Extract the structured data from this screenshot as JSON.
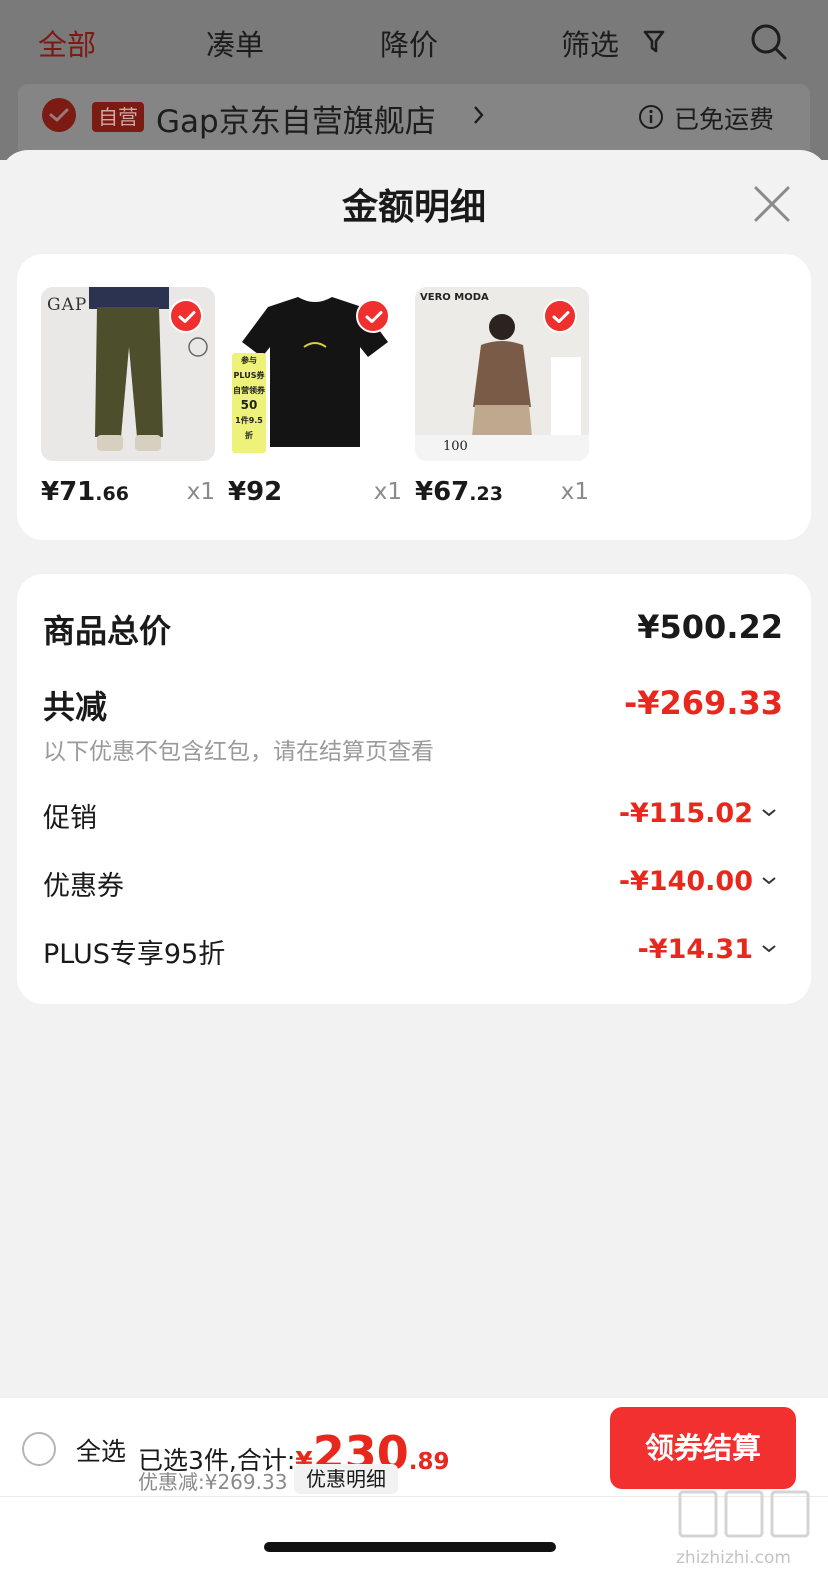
{
  "background": {
    "tabs": [
      "全部",
      "凑单",
      "降价",
      "筛选"
    ],
    "active_tab": "全部",
    "store": {
      "tag": "自营",
      "name": "Gap京东自营旗舰店",
      "shipping": "已免运费"
    }
  },
  "sheet": {
    "title": "金额明细",
    "products": [
      {
        "price_int": "¥71",
        "price_dec": ".66",
        "qty": "x1",
        "brand_text": "GAP"
      },
      {
        "price_int": "¥92",
        "price_dec": "",
        "qty": "x1",
        "promo_lines": [
          "参与",
          "PLUS券",
          "自营领券",
          "50",
          "1件9.5折"
        ]
      },
      {
        "price_int": "¥67",
        "price_dec": ".23",
        "qty": "x1",
        "brand_text": "VERO MODA",
        "promo_price": "100"
      }
    ],
    "summary": {
      "total_label": "商品总价",
      "total_value": "¥500.22",
      "reduce_label": "共减",
      "reduce_value": "-¥269.33",
      "hint": "以下优惠不包含红包，请在结算页查看",
      "items": [
        {
          "label": "促销",
          "value": "-¥115.02"
        },
        {
          "label": "优惠券",
          "value": "-¥140.00"
        },
        {
          "label": "PLUS专享95折",
          "value": "-¥14.31"
        }
      ]
    }
  },
  "bottom": {
    "select_all": "全选",
    "selected_text": "已选3件,合计:",
    "total_yen": "¥",
    "total_int": "230",
    "total_dec": ".89",
    "discount_text": "优惠减:¥269.33",
    "detail_chip": "优惠明细",
    "checkout": "领券结算",
    "watermark": "zhizhizhi.com"
  },
  "colors": {
    "accent": "#f2302f",
    "price_red": "#e8271d",
    "dim_overlay": "#7a7a7a"
  }
}
